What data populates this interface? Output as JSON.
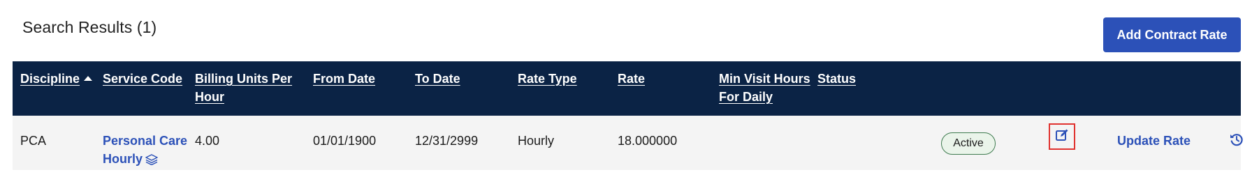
{
  "page": {
    "results_title": "Search Results (1)",
    "add_button_label": "Add Contract Rate"
  },
  "table": {
    "headers": {
      "discipline": "Discipline",
      "service_code": "Service Code",
      "billing_units_line1": "Billing Units Per",
      "billing_units_line2": "Hour",
      "from_date": "From Date",
      "to_date": "To Date",
      "rate_type": "Rate Type",
      "rate": "Rate",
      "min_visit_line1": "Min Visit Hours",
      "min_visit_line2": "For Daily",
      "status": "Status"
    },
    "sort": {
      "column": "discipline",
      "direction": "ascending",
      "icon": "sort-ascending-icon"
    },
    "rows": [
      {
        "discipline": "PCA",
        "service_code_line1": "Personal Care",
        "service_code_line2": "Hourly",
        "billing_units": "4.00",
        "from_date": "01/01/1900",
        "to_date": "12/31/2999",
        "rate_type": "Hourly",
        "rate": "18.000000",
        "min_visit_hours": "",
        "status": "Active",
        "update_rate_label": "Update Rate",
        "icons": {
          "service_code": "layers-icon",
          "edit": "edit-icon",
          "history": "history-icon"
        }
      }
    ]
  },
  "colors": {
    "header_bg": "#0b2345",
    "accent": "#2c51b8",
    "row_bg": "#f4f4f4",
    "status_border": "#3e7b4f",
    "highlight": "#e0322f"
  }
}
